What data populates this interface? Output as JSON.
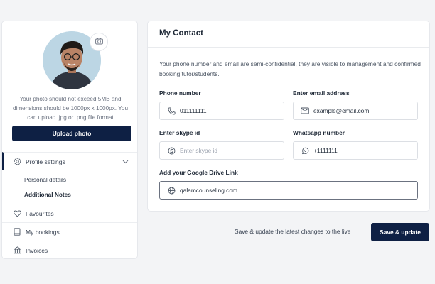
{
  "profile": {
    "photo_hint": "Your photo should not exceed 5MB and dimensions should be 1000px x 1000px. You can upload .jpg or .png file format",
    "upload_label": "Upload photo",
    "camera_icon": "camera-icon"
  },
  "sidebar": {
    "items": [
      {
        "label": "Profile settings",
        "icon": "gear-icon",
        "expanded": true
      },
      {
        "label": "Personal details"
      },
      {
        "label": "Additional Notes"
      },
      {
        "label": "Favourites",
        "icon": "heart-icon"
      },
      {
        "label": "My bookings",
        "icon": "book-icon"
      },
      {
        "label": "Invoices",
        "icon": "bank-icon"
      }
    ]
  },
  "contact": {
    "title": "My Contact",
    "intro": "Your phone number and email are semi-confidential, they are visible to management and confirmed booking tutor/students.",
    "fields": {
      "phone": {
        "label": "Phone number",
        "value": "011111111",
        "icon": "phone-icon"
      },
      "email": {
        "label": "Enter email address",
        "value": "example@email.com",
        "icon": "mail-icon"
      },
      "skype": {
        "label": "Enter skype id",
        "placeholder": "Enter skype id",
        "value": "",
        "icon": "skype-icon"
      },
      "whatsapp": {
        "label": "Whatsapp number",
        "value": "+1111111",
        "icon": "whatsapp-icon"
      },
      "drive": {
        "label": "Add your Google Drive Link",
        "value": "qalamcounseling.com",
        "icon": "globe-icon"
      }
    }
  },
  "footer": {
    "note": "Save & update the latest changes to the live",
    "save_label": "Save & update"
  },
  "colors": {
    "primary": "#0e2044",
    "background": "#f3f4f6",
    "border": "#dcdfe4"
  }
}
